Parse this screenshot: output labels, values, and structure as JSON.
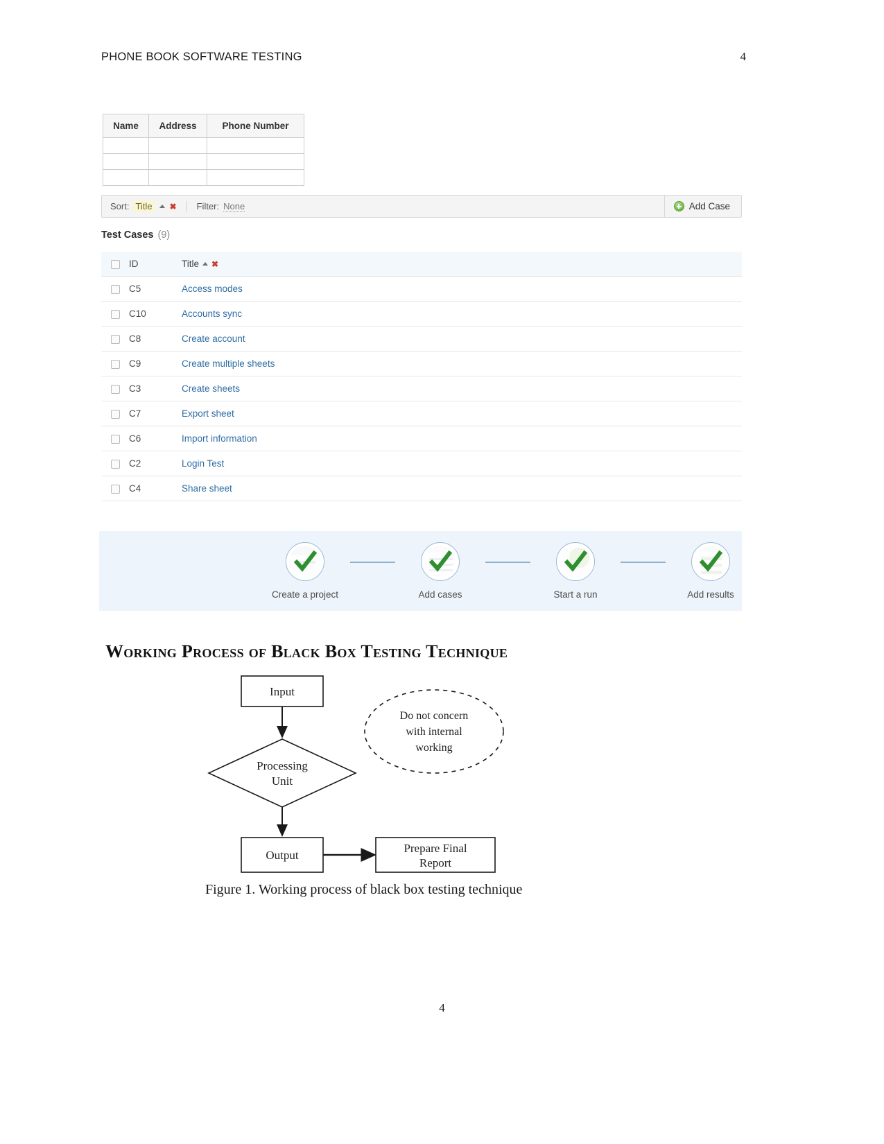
{
  "header": {
    "running_title": "PHONE BOOK SOFTWARE TESTING",
    "page_number": "4"
  },
  "contacts_table": {
    "columns": [
      "Name",
      "Address",
      "Phone Number"
    ],
    "rows": [
      [
        "",
        "",
        ""
      ],
      [
        "",
        "",
        ""
      ],
      [
        "",
        "",
        ""
      ]
    ]
  },
  "toolbar": {
    "sort_label": "Sort:",
    "sort_value": "Title",
    "sort_direction_icon": "caret-up-icon",
    "sort_clear_icon": "red-x-icon",
    "filter_label": "Filter:",
    "filter_value": "None",
    "add_case_label": "Add Case",
    "add_case_icon": "green-plus-circle-icon"
  },
  "test_cases": {
    "heading": "Test Cases",
    "count": "(9)",
    "columns": {
      "id": "ID",
      "title": "Title",
      "sort_direction_icon": "caret-up-icon",
      "sort_clear_icon": "red-x-icon"
    },
    "rows": [
      {
        "id": "C5",
        "title": "Access modes"
      },
      {
        "id": "C10",
        "title": "Accounts sync"
      },
      {
        "id": "C8",
        "title": "Create account"
      },
      {
        "id": "C9",
        "title": "Create multiple sheets"
      },
      {
        "id": "C3",
        "title": "Create sheets"
      },
      {
        "id": "C7",
        "title": "Export sheet"
      },
      {
        "id": "C6",
        "title": "Import information"
      },
      {
        "id": "C2",
        "title": "Login Test"
      },
      {
        "id": "C4",
        "title": "Share sheet"
      }
    ]
  },
  "steps_banner": {
    "steps": [
      {
        "label": "Create a project",
        "icon": "green-check-icon"
      },
      {
        "label": "Add cases",
        "icon": "green-check-icon"
      },
      {
        "label": "Start a run",
        "icon": "green-check-icon"
      },
      {
        "label": "Add results",
        "icon": "green-check-icon"
      }
    ]
  },
  "black_box_figure": {
    "title": "Working Process of Black Box Testing Technique",
    "nodes": {
      "input": "Input",
      "processing_unit_line1": "Processing",
      "processing_unit_line2": "Unit",
      "output": "Output",
      "final_report_line1": "Prepare Final",
      "final_report_line2": "Report",
      "note_line1": "Do not concern",
      "note_line2": "with internal",
      "note_line3": "working"
    },
    "caption": "Figure 1.  Working process of black box testing technique"
  },
  "footer": {
    "page_number": "4"
  },
  "colors": {
    "link": "#2e6da4",
    "banner_bg": "#eef4fb",
    "check_green": "#2f8f2f",
    "accent_red": "#cc3b33",
    "sort_highlight": "#fbf5d5"
  }
}
